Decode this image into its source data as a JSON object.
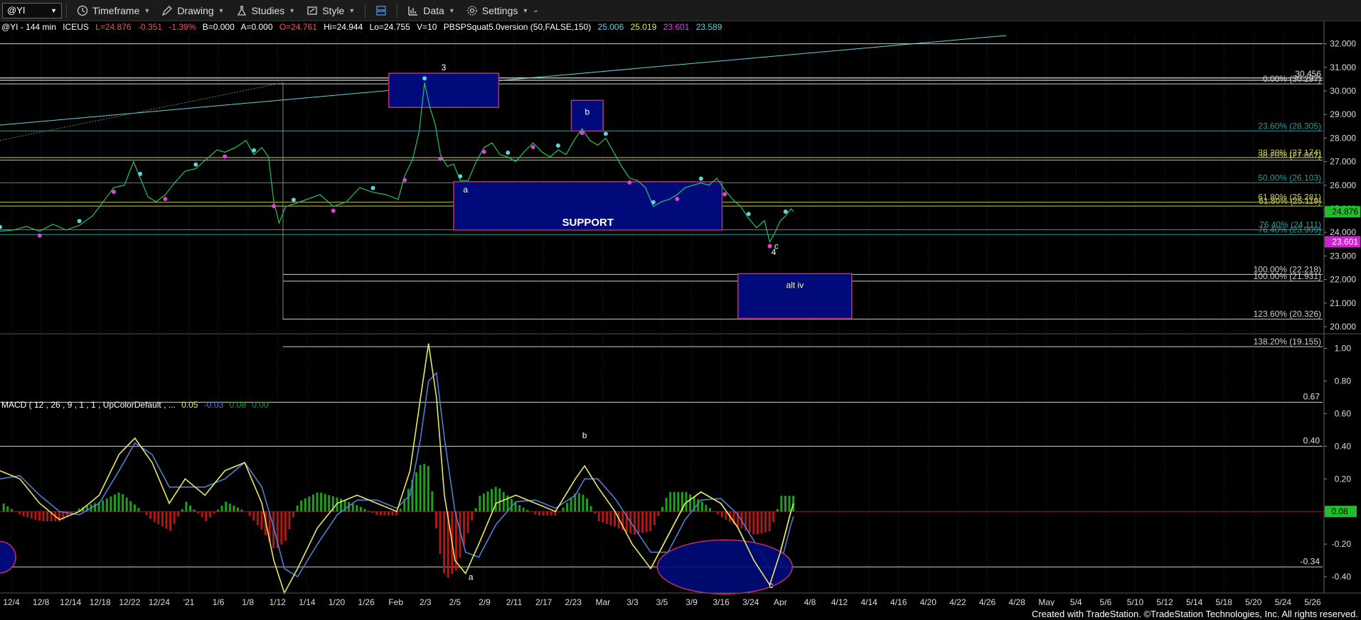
{
  "toolbar": {
    "symbol": "@YI",
    "timeframe": "Timeframe",
    "drawing": "Drawing",
    "studies": "Studies",
    "style": "Style",
    "data": "Data",
    "settings": "Settings"
  },
  "info": {
    "symbol": "@YI - 144 min",
    "exchange": "ICEUS",
    "last": "L=24.876",
    "change": "-0.351",
    "pct": "-1.39%",
    "bid": "B=0.000",
    "ask": "A=0.000",
    "open": "O=24.761",
    "high": "Hi=24.944",
    "low": "Lo=24.755",
    "vol": "V=10",
    "study": "PBSPSquat5.0version (50,FALSE,150)",
    "s1": "25.006",
    "s2": "25.019",
    "s3": "23.601",
    "s4": "23.589"
  },
  "macd_info": {
    "label": "MACD ( 12 , 26 , 9 , 1 , 1 , UpColorDefault , ...",
    "v1": "0.05",
    "v2": "-0.03",
    "v3": "0.08",
    "v4": "0.00"
  },
  "colors": {
    "price_green": "#22c55e",
    "cyan": "#5fd3e0",
    "magenta": "#e040e0",
    "box_fill": "#000a7a",
    "box_border": "#c0306a",
    "last_badge": "#1fbf2a",
    "low_badge": "#d020d0",
    "macd_yellow": "#e8e860",
    "macd_blue": "#4e7fd0",
    "hist_green": "#1ea01e",
    "hist_red": "#b01818"
  },
  "chart_data": {
    "type": "candlestick-price-with-macd",
    "price_axis": {
      "ticks": [
        "32.000",
        "31.000",
        "30.000",
        "29.000",
        "28.000",
        "27.000",
        "26.000",
        "25.000",
        "24.000",
        "23.000",
        "22.000",
        "21.000",
        "20.000"
      ],
      "ylim": [
        19.7,
        32.35
      ],
      "last_badge": "24.876",
      "low_badge": "23.601",
      "top_badge": "30.456"
    },
    "x_axis": {
      "labels": [
        "12/4",
        "12/8",
        "12/14",
        "12/18",
        "12/22",
        "12/24",
        "'21",
        "1/6",
        "1/8",
        "1/12",
        "1/14",
        "1/20",
        "1/26",
        "Feb",
        "2/3",
        "2/5",
        "2/9",
        "2/11",
        "2/17",
        "2/23",
        "Mar",
        "3/3",
        "3/5",
        "3/9",
        "3/16",
        "3/24",
        "Apr",
        "4/8",
        "4/12",
        "4/14",
        "4/16",
        "4/20",
        "4/22",
        "4/26",
        "4/28",
        "May",
        "5/4",
        "5/6",
        "5/10",
        "5/12",
        "5/14",
        "5/18",
        "5/20",
        "5/24",
        "5/26"
      ]
    },
    "fib_levels": [
      {
        "label": "0.00% (30.297)",
        "value": 30.297
      },
      {
        "label": "23.60% (28.305)",
        "value": 28.305
      },
      {
        "label": "38.20% (27.174)",
        "value": 27.174
      },
      {
        "label": "38.20% (27.067)",
        "value": 27.067
      },
      {
        "label": "50.00% (26.103)",
        "value": 26.103
      },
      {
        "label": "61.80% (25.281)",
        "value": 25.281
      },
      {
        "label": "61.80% (25.119)",
        "value": 25.119
      },
      {
        "label": "76.40% (24.111)",
        "value": 24.111
      },
      {
        "label": "76.40% (23.909)",
        "value": 23.909
      },
      {
        "label": "100.00% (22.218)",
        "value": 22.218
      },
      {
        "label": "100.00% (21.931)",
        "value": 21.931
      },
      {
        "label": "123.60% (20.326)",
        "value": 20.326
      },
      {
        "label": "138.20% (19.155)",
        "value": 19.155
      }
    ],
    "boxes": [
      {
        "label": "3",
        "x1": 0.294,
        "x2": 0.377,
        "y1": 30.75,
        "y2": 29.3
      },
      {
        "label": "b",
        "x1": 0.432,
        "x2": 0.456,
        "y1": 29.6,
        "y2": 28.3
      },
      {
        "label": "SUPPORT",
        "x1": 0.343,
        "x2": 0.546,
        "y1": 26.15,
        "y2": 24.1
      },
      {
        "label": "alt iv",
        "x1": 0.558,
        "x2": 0.644,
        "y1": 22.25,
        "y2": 20.35
      }
    ],
    "wave_labels": [
      {
        "text": "a",
        "x": 0.352,
        "y": 25.7
      },
      {
        "text": "c",
        "x": 0.587,
        "y": 23.3
      },
      {
        "text": "4",
        "x": 0.585,
        "y": 23.05
      }
    ],
    "price_series": [
      [
        0.0,
        24.05
      ],
      [
        0.01,
        24.1
      ],
      [
        0.02,
        24.25
      ],
      [
        0.03,
        24.05
      ],
      [
        0.04,
        24.35
      ],
      [
        0.05,
        24.1
      ],
      [
        0.06,
        24.3
      ],
      [
        0.07,
        24.7
      ],
      [
        0.078,
        25.3
      ],
      [
        0.086,
        25.9
      ],
      [
        0.094,
        26.0
      ],
      [
        0.101,
        27.0
      ],
      [
        0.106,
        26.3
      ],
      [
        0.112,
        25.5
      ],
      [
        0.118,
        25.3
      ],
      [
        0.125,
        25.6
      ],
      [
        0.132,
        26.1
      ],
      [
        0.14,
        26.6
      ],
      [
        0.148,
        26.7
      ],
      [
        0.156,
        27.1
      ],
      [
        0.164,
        27.5
      ],
      [
        0.17,
        27.4
      ],
      [
        0.178,
        27.6
      ],
      [
        0.186,
        27.9
      ],
      [
        0.192,
        27.3
      ],
      [
        0.198,
        27.6
      ],
      [
        0.203,
        27.2
      ],
      [
        0.207,
        25.3
      ],
      [
        0.211,
        24.4
      ],
      [
        0.216,
        25.1
      ],
      [
        0.222,
        25.2
      ],
      [
        0.232,
        25.4
      ],
      [
        0.242,
        25.6
      ],
      [
        0.252,
        25.1
      ],
      [
        0.262,
        25.3
      ],
      [
        0.272,
        25.9
      ],
      [
        0.282,
        25.7
      ],
      [
        0.292,
        25.6
      ],
      [
        0.301,
        25.4
      ],
      [
        0.306,
        26.4
      ],
      [
        0.312,
        27.1
      ],
      [
        0.317,
        28.3
      ],
      [
        0.321,
        30.35
      ],
      [
        0.325,
        29.3
      ],
      [
        0.329,
        28.6
      ],
      [
        0.333,
        27.3
      ],
      [
        0.338,
        26.8
      ],
      [
        0.343,
        26.9
      ],
      [
        0.348,
        26.2
      ],
      [
        0.354,
        26.2
      ],
      [
        0.36,
        27.0
      ],
      [
        0.366,
        27.6
      ],
      [
        0.372,
        27.8
      ],
      [
        0.378,
        27.3
      ],
      [
        0.384,
        27.2
      ],
      [
        0.39,
        27.0
      ],
      [
        0.396,
        27.4
      ],
      [
        0.403,
        27.8
      ],
      [
        0.41,
        27.4
      ],
      [
        0.416,
        27.2
      ],
      [
        0.422,
        27.5
      ],
      [
        0.428,
        27.3
      ],
      [
        0.434,
        27.9
      ],
      [
        0.44,
        28.4
      ],
      [
        0.446,
        27.9
      ],
      [
        0.452,
        27.7
      ],
      [
        0.458,
        28.0
      ],
      [
        0.464,
        27.4
      ],
      [
        0.47,
        26.8
      ],
      [
        0.476,
        26.3
      ],
      [
        0.482,
        26.2
      ],
      [
        0.488,
        25.9
      ],
      [
        0.494,
        25.1
      ],
      [
        0.5,
        25.3
      ],
      [
        0.506,
        25.4
      ],
      [
        0.512,
        25.6
      ],
      [
        0.518,
        25.9
      ],
      [
        0.524,
        26.0
      ],
      [
        0.53,
        26.1
      ],
      [
        0.536,
        26.0
      ],
      [
        0.542,
        26.3
      ],
      [
        0.548,
        25.8
      ],
      [
        0.554,
        25.4
      ],
      [
        0.56,
        25.1
      ],
      [
        0.566,
        24.6
      ],
      [
        0.572,
        24.2
      ],
      [
        0.578,
        24.5
      ],
      [
        0.582,
        23.6
      ],
      [
        0.586,
        24.0
      ],
      [
        0.59,
        24.5
      ],
      [
        0.594,
        24.7
      ],
      [
        0.598,
        25.0
      ],
      [
        0.6,
        24.88
      ]
    ],
    "macd": {
      "ticks": [
        "1.00",
        "0.80",
        "0.60",
        "0.40",
        "0.20",
        "0.00",
        "-0.20",
        "-0.40"
      ],
      "ylim": [
        -0.5,
        1.09
      ],
      "levels": [
        {
          "label": "0.67",
          "value": 0.67
        },
        {
          "label": "0.40",
          "value": 0.4
        },
        {
          "label": "-0.34",
          "value": -0.34
        }
      ],
      "last_badge": "0.08",
      "wave_labels": [
        {
          "text": "b",
          "x": 0.442,
          "y": 0.45
        },
        {
          "text": "a",
          "x": 0.356,
          "y": -0.42
        },
        {
          "text": "c",
          "x": 0.583,
          "y": -0.47
        }
      ],
      "macd_line": [
        [
          0.0,
          0.25
        ],
        [
          0.015,
          0.2
        ],
        [
          0.03,
          0.05
        ],
        [
          0.045,
          -0.05
        ],
        [
          0.06,
          0.0
        ],
        [
          0.075,
          0.1
        ],
        [
          0.09,
          0.35
        ],
        [
          0.102,
          0.45
        ],
        [
          0.115,
          0.3
        ],
        [
          0.128,
          0.05
        ],
        [
          0.14,
          0.2
        ],
        [
          0.155,
          0.1
        ],
        [
          0.17,
          0.25
        ],
        [
          0.185,
          0.3
        ],
        [
          0.198,
          0.05
        ],
        [
          0.207,
          -0.3
        ],
        [
          0.215,
          -0.5
        ],
        [
          0.225,
          -0.35
        ],
        [
          0.24,
          -0.1
        ],
        [
          0.255,
          0.05
        ],
        [
          0.27,
          0.1
        ],
        [
          0.285,
          0.05
        ],
        [
          0.3,
          0.0
        ],
        [
          0.31,
          0.25
        ],
        [
          0.318,
          0.7
        ],
        [
          0.324,
          1.03
        ],
        [
          0.33,
          0.7
        ],
        [
          0.336,
          0.1
        ],
        [
          0.344,
          -0.3
        ],
        [
          0.352,
          -0.38
        ],
        [
          0.362,
          -0.2
        ],
        [
          0.375,
          0.05
        ],
        [
          0.39,
          0.1
        ],
        [
          0.405,
          0.05
        ],
        [
          0.42,
          0.0
        ],
        [
          0.435,
          0.2
        ],
        [
          0.442,
          0.28
        ],
        [
          0.452,
          0.15
        ],
        [
          0.465,
          0.0
        ],
        [
          0.478,
          -0.2
        ],
        [
          0.492,
          -0.35
        ],
        [
          0.505,
          -0.15
        ],
        [
          0.518,
          0.05
        ],
        [
          0.53,
          0.12
        ],
        [
          0.545,
          0.05
        ],
        [
          0.558,
          -0.1
        ],
        [
          0.57,
          -0.3
        ],
        [
          0.582,
          -0.45
        ],
        [
          0.59,
          -0.25
        ],
        [
          0.598,
          0.0
        ],
        [
          0.6,
          0.05
        ]
      ],
      "signal_line": [
        [
          0.0,
          0.2
        ],
        [
          0.015,
          0.22
        ],
        [
          0.03,
          0.1
        ],
        [
          0.045,
          0.0
        ],
        [
          0.06,
          -0.02
        ],
        [
          0.075,
          0.05
        ],
        [
          0.09,
          0.25
        ],
        [
          0.102,
          0.42
        ],
        [
          0.115,
          0.35
        ],
        [
          0.128,
          0.15
        ],
        [
          0.14,
          0.15
        ],
        [
          0.155,
          0.15
        ],
        [
          0.17,
          0.2
        ],
        [
          0.185,
          0.3
        ],
        [
          0.198,
          0.15
        ],
        [
          0.207,
          -0.1
        ],
        [
          0.215,
          -0.35
        ],
        [
          0.225,
          -0.4
        ],
        [
          0.24,
          -0.2
        ],
        [
          0.255,
          -0.02
        ],
        [
          0.27,
          0.07
        ],
        [
          0.285,
          0.07
        ],
        [
          0.3,
          0.02
        ],
        [
          0.31,
          0.1
        ],
        [
          0.318,
          0.45
        ],
        [
          0.324,
          0.8
        ],
        [
          0.33,
          0.85
        ],
        [
          0.336,
          0.45
        ],
        [
          0.344,
          0.0
        ],
        [
          0.352,
          -0.25
        ],
        [
          0.362,
          -0.28
        ],
        [
          0.375,
          -0.08
        ],
        [
          0.39,
          0.06
        ],
        [
          0.405,
          0.07
        ],
        [
          0.42,
          0.02
        ],
        [
          0.435,
          0.1
        ],
        [
          0.442,
          0.2
        ],
        [
          0.452,
          0.2
        ],
        [
          0.465,
          0.08
        ],
        [
          0.478,
          -0.08
        ],
        [
          0.492,
          -0.25
        ],
        [
          0.505,
          -0.25
        ],
        [
          0.518,
          -0.05
        ],
        [
          0.53,
          0.07
        ],
        [
          0.545,
          0.08
        ],
        [
          0.558,
          -0.02
        ],
        [
          0.57,
          -0.18
        ],
        [
          0.582,
          -0.35
        ],
        [
          0.59,
          -0.33
        ],
        [
          0.598,
          -0.08
        ],
        [
          0.6,
          -0.03
        ]
      ]
    }
  },
  "footer": {
    "credit": "Created with TradeStation. ©TradeStation Technologies, Inc. All rights reserved."
  }
}
